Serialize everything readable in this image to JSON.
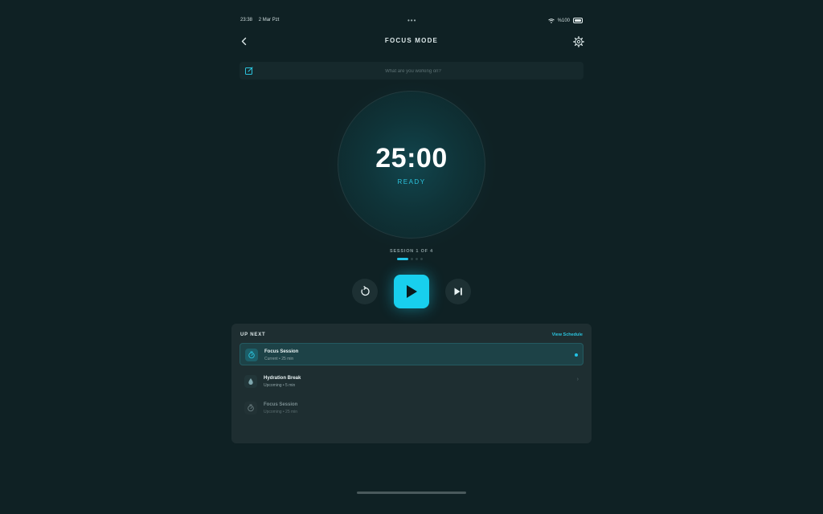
{
  "status_bar": {
    "time": "23:38",
    "date": "2 Mar Pzt",
    "battery": "%100"
  },
  "header": {
    "title": "FOCUS MODE"
  },
  "task": {
    "placeholder": "What are you working on?"
  },
  "timer": {
    "time": "25:00",
    "status": "READY"
  },
  "session": {
    "label": "SESSION 1 OF 4",
    "current": 1,
    "total": 4
  },
  "up_next": {
    "title": "UP NEXT",
    "view_schedule": "View Schedule",
    "items": [
      {
        "name": "Focus Session",
        "meta": "Current • 25 min",
        "icon": "timer-icon",
        "state": "current"
      },
      {
        "name": "Hydration Break",
        "meta": "Upcoming • 5 min",
        "icon": "water-drop-icon",
        "state": "upcoming"
      },
      {
        "name": "Focus Session",
        "meta": "Upcoming • 25 min",
        "icon": "timer-icon",
        "state": "later"
      }
    ]
  },
  "colors": {
    "background": "#0f2124",
    "accent": "#18cfee",
    "panel": "#1e2e31"
  }
}
